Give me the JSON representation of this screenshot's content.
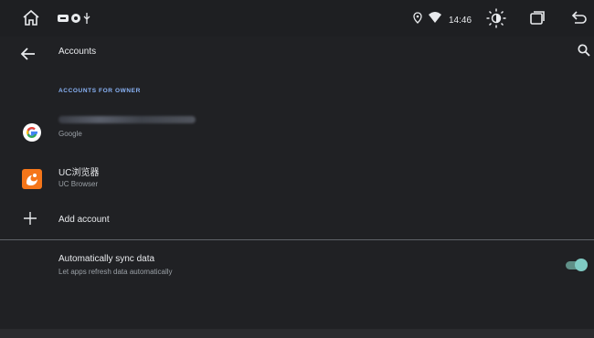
{
  "statusbar": {
    "time": "14:46",
    "icons": [
      "home-icon",
      "notification-icon",
      "usb-icon",
      "location-icon",
      "wifi-icon",
      "brightness-icon",
      "recents-icon",
      "back-nav-icon"
    ]
  },
  "appbar": {
    "title": "Accounts",
    "back_icon": "arrow-back-icon",
    "search_icon": "search-icon"
  },
  "section": {
    "header": "ACCOUNTS FOR OWNER"
  },
  "accounts": [
    {
      "name": "",
      "type": "Google",
      "icon": "google-icon"
    },
    {
      "name": "UC浏览器",
      "type": "UC Browser",
      "icon": "uc-browser-icon"
    }
  ],
  "add_account": {
    "label": "Add account",
    "icon": "plus-icon"
  },
  "sync": {
    "title": "Automatically sync data",
    "subtitle": "Let apps refresh data automatically",
    "enabled": true
  },
  "colors": {
    "background": "#202124",
    "accent": "#80cbc4",
    "section_header": "#8ab4f8"
  }
}
